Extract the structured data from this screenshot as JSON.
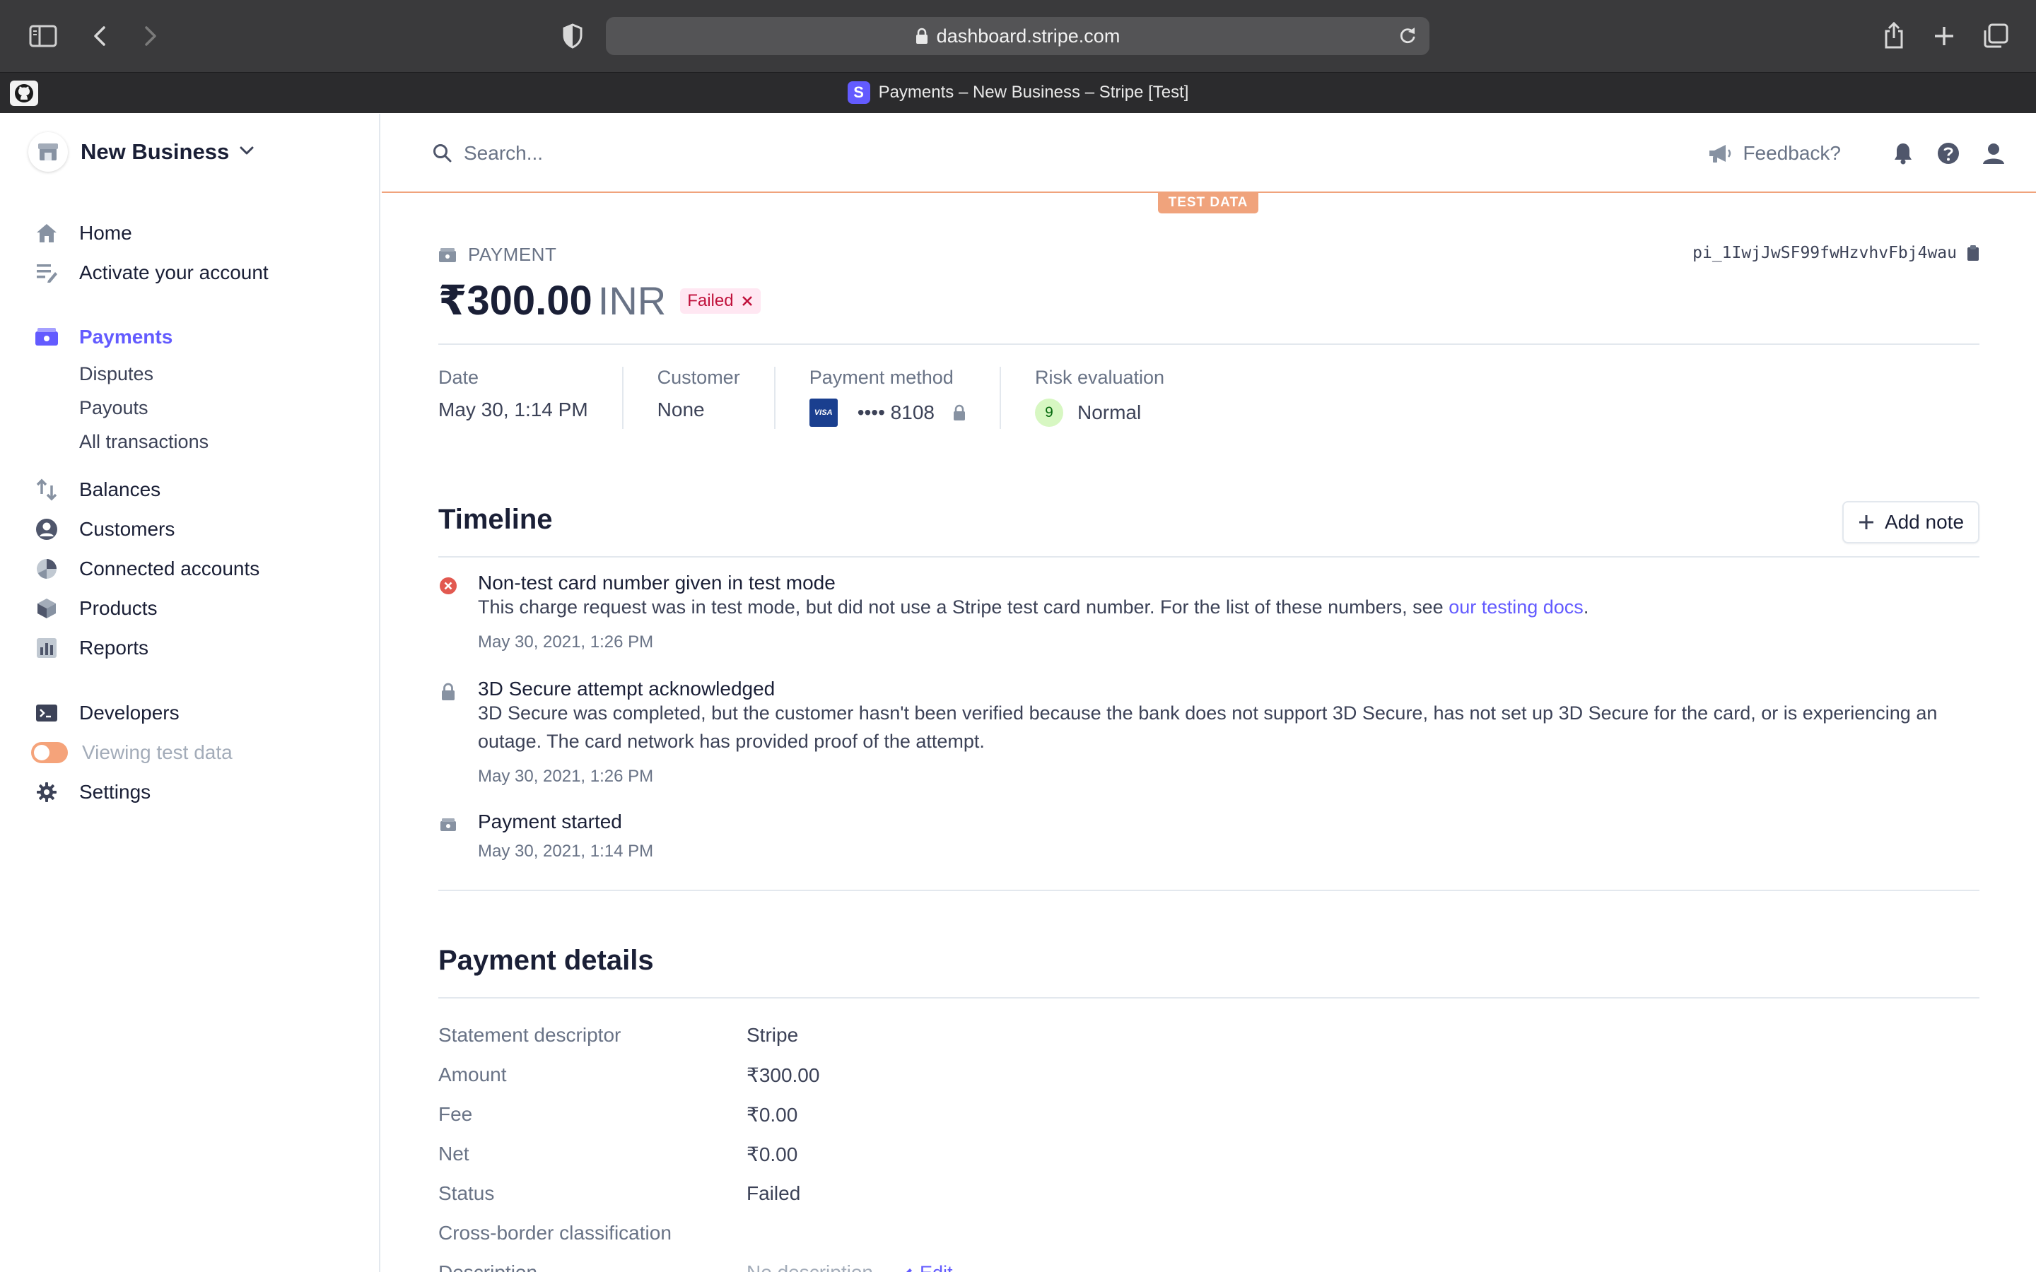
{
  "browser": {
    "url": "dashboard.stripe.com",
    "tab_title": "Payments – New Business – Stripe [Test]",
    "favicon_letter": "S"
  },
  "sidebar": {
    "account_name": "New Business",
    "items": [
      {
        "label": "Home",
        "icon": "home-icon"
      },
      {
        "label": "Activate your account",
        "icon": "checklist-icon"
      },
      {
        "label": "Payments",
        "icon": "payments-icon",
        "active": true
      },
      {
        "label": "Disputes"
      },
      {
        "label": "Payouts"
      },
      {
        "label": "All transactions"
      },
      {
        "label": "Balances",
        "icon": "balances-icon"
      },
      {
        "label": "Customers",
        "icon": "customers-icon"
      },
      {
        "label": "Connected accounts",
        "icon": "connected-accounts-icon"
      },
      {
        "label": "Products",
        "icon": "products-icon"
      },
      {
        "label": "Reports",
        "icon": "reports-icon"
      },
      {
        "label": "Developers",
        "icon": "developers-icon"
      },
      {
        "label": "Viewing test data",
        "icon": "toggle"
      },
      {
        "label": "Settings",
        "icon": "gear-icon"
      }
    ]
  },
  "header": {
    "search_placeholder": "Search...",
    "feedback_label": "Feedback?",
    "test_badge": "TEST DATA"
  },
  "payment": {
    "label": "PAYMENT",
    "id": "pi_1IwjJwSF99fwHzvhvFbj4wau",
    "amount": "₹300.00",
    "currency": "INR",
    "status": "Failed",
    "status_color": "#c0123c"
  },
  "meta": {
    "date_label": "Date",
    "date_value": "May 30, 1:14 PM",
    "customer_label": "Customer",
    "customer_value": "None",
    "method_label": "Payment method",
    "method_brand": "VISA",
    "method_value": "•••• 8108",
    "risk_label": "Risk evaluation",
    "risk_score": "9",
    "risk_value": "Normal"
  },
  "timeline": {
    "title": "Timeline",
    "add_note_label": "Add note",
    "events": [
      {
        "title": "Non-test card number given in test mode",
        "desc": "This charge request was in test mode, but did not use a Stripe test card number. For the list of these numbers, see ",
        "link": "our testing docs",
        "desc_end": ".",
        "date": "May 30, 2021, 1:26 PM",
        "icon": "error-icon"
      },
      {
        "title": "3D Secure attempt acknowledged",
        "desc": "3D Secure was completed, but the customer hasn't been verified because the bank does not support 3D Secure, has not set up 3D Secure for the card, or is experiencing an outage. The card network has provided proof of the attempt.",
        "date": "May 30, 2021, 1:26 PM",
        "icon": "lock-icon"
      },
      {
        "title": "Payment started",
        "date": "May 30, 2021, 1:14 PM",
        "icon": "payment-icon"
      }
    ]
  },
  "details": {
    "title": "Payment details",
    "rows": [
      {
        "key": "Statement descriptor",
        "value": "Stripe"
      },
      {
        "key": "Amount",
        "value": "₹300.00"
      },
      {
        "key": "Fee",
        "value": "₹0.00"
      },
      {
        "key": "Net",
        "value": "₹0.00"
      },
      {
        "key": "Status",
        "value": "Failed"
      },
      {
        "key": "Cross-border classification",
        "value": ""
      },
      {
        "key": "Description",
        "value": "No description"
      }
    ],
    "edit_label": "Edit"
  },
  "colors": {
    "accent": "#635bff",
    "test_orange": "#f0a37c",
    "failed_bg": "#ffe7f2"
  }
}
